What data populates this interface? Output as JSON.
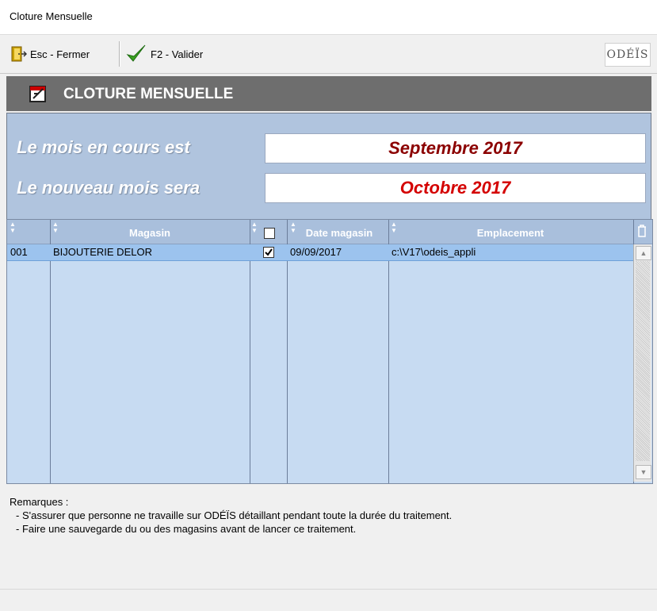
{
  "window": {
    "title": "Cloture Mensuelle"
  },
  "toolbar": {
    "close_label": "Esc - Fermer",
    "validate_label": "F2 - Valider",
    "logo_text": "ODÉÏS"
  },
  "header": {
    "title": "CLOTURE MENSUELLE"
  },
  "months": {
    "current_label": "Le mois en cours est",
    "current_value": "Septembre 2017",
    "new_label": "Le nouveau mois sera",
    "new_value": "Octobre 2017",
    "current_color": "#8b0000",
    "new_color": "#d40000"
  },
  "grid": {
    "columns": {
      "magasin": "Magasin",
      "date": "Date magasin",
      "emplacement": "Emplacement"
    },
    "rows": [
      {
        "code": "001",
        "magasin": "BIJOUTERIE DELOR",
        "checked": true,
        "date": "09/09/2017",
        "emplacement": "c:\\V17\\odeis_appli"
      }
    ]
  },
  "remarks": {
    "title": "Remarques :",
    "line1": "- S'assurer que personne ne travaille sur ODÉÏS détaillant pendant toute la durée du traitement.",
    "line2": "- Faire une sauvegarde du ou des magasins avant de lancer ce traitement."
  },
  "colors": {
    "panel": "#b0c4de",
    "header": "#6e6e6e",
    "row_selected": "#9cc3ee"
  }
}
